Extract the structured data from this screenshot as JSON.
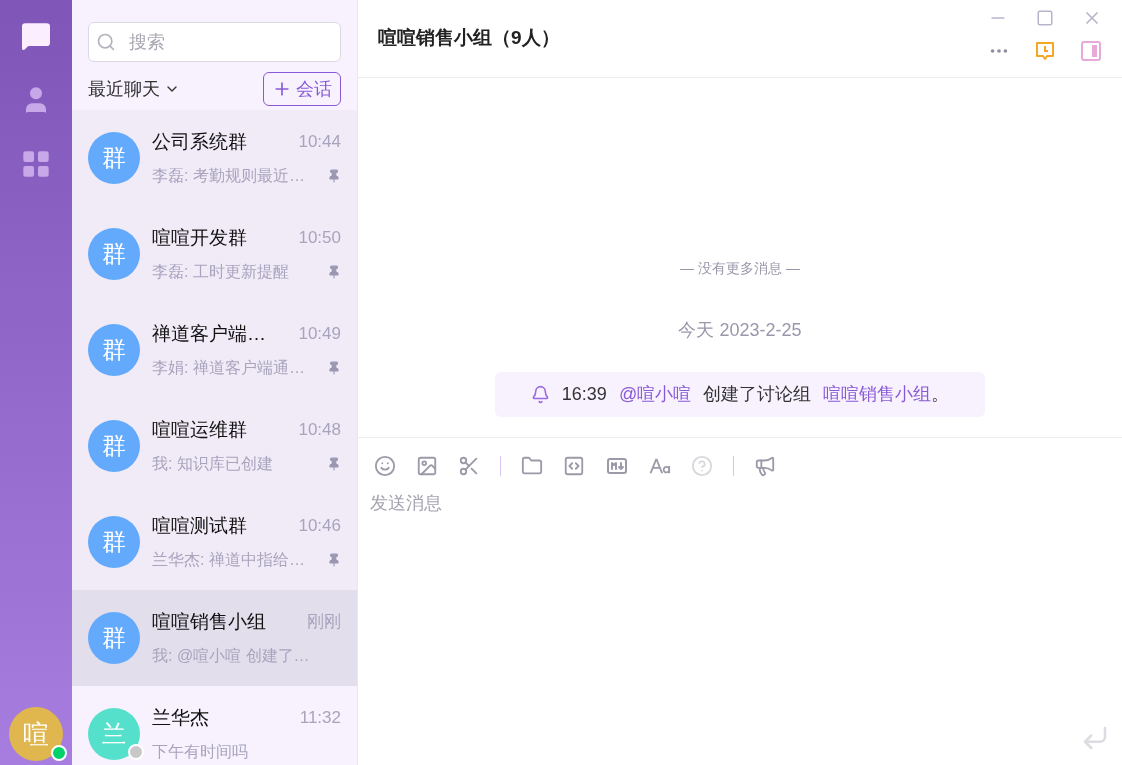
{
  "nav_items": [
    {
      "kind": "chat",
      "selected": true
    },
    {
      "kind": "contacts",
      "selected": false
    },
    {
      "kind": "apps",
      "selected": false
    }
  ],
  "user": {
    "avatar": "喧",
    "online": true
  },
  "search": {
    "placeholder": "搜索"
  },
  "list_filter": "最近聊天",
  "new_chat_button": "会话",
  "conversations": [
    {
      "avatar": "群",
      "color": "#64aafc",
      "name": "公司系统群",
      "time": "10:44",
      "preview": "李磊: 考勤规则最近…",
      "pinned": true,
      "selected": false
    },
    {
      "avatar": "群",
      "color": "#64aafc",
      "name": "喧喧开发群",
      "time": "10:50",
      "preview": "李磊: 工时更新提醒",
      "pinned": true,
      "selected": false
    },
    {
      "avatar": "群",
      "color": "#64aafc",
      "name": "禅道客户端…",
      "time": "10:49",
      "preview": "李娟: 禅道客户端通…",
      "pinned": true,
      "selected": false
    },
    {
      "avatar": "群",
      "color": "#64aafc",
      "name": "喧喧运维群",
      "time": "10:48",
      "preview": "我: 知识库已创建",
      "pinned": true,
      "selected": false
    },
    {
      "avatar": "群",
      "color": "#64aafc",
      "name": "喧喧测试群",
      "time": "10:46",
      "preview": "兰华杰: 禅道中指给…",
      "pinned": true,
      "selected": false
    },
    {
      "avatar": "群",
      "color": "#64aafc",
      "name": "喧喧销售小组",
      "time": "刚刚",
      "preview": "我: @喧小喧 创建了…",
      "pinned": false,
      "selected": true
    },
    {
      "avatar": "兰",
      "color": "#55e0cc",
      "name": "兰华杰",
      "time": "11:32",
      "preview": "下午有时间吗",
      "pinned": false,
      "selected": false,
      "online": false
    }
  ],
  "chat": {
    "title": "喧喧销售小组（9人）",
    "no_more": "— 没有更多消息 —",
    "date": "今天 2023-2-25",
    "notice": [
      {
        "kind": "time",
        "text": "16:39"
      },
      {
        "kind": "mention",
        "text": "@喧小喧"
      },
      {
        "kind": "plain",
        "text": "创建了讨论组"
      },
      {
        "kind": "link",
        "text": "喧喧销售小组"
      },
      {
        "kind": "plain",
        "text": "。"
      }
    ],
    "input_placeholder": "发送消息"
  }
}
